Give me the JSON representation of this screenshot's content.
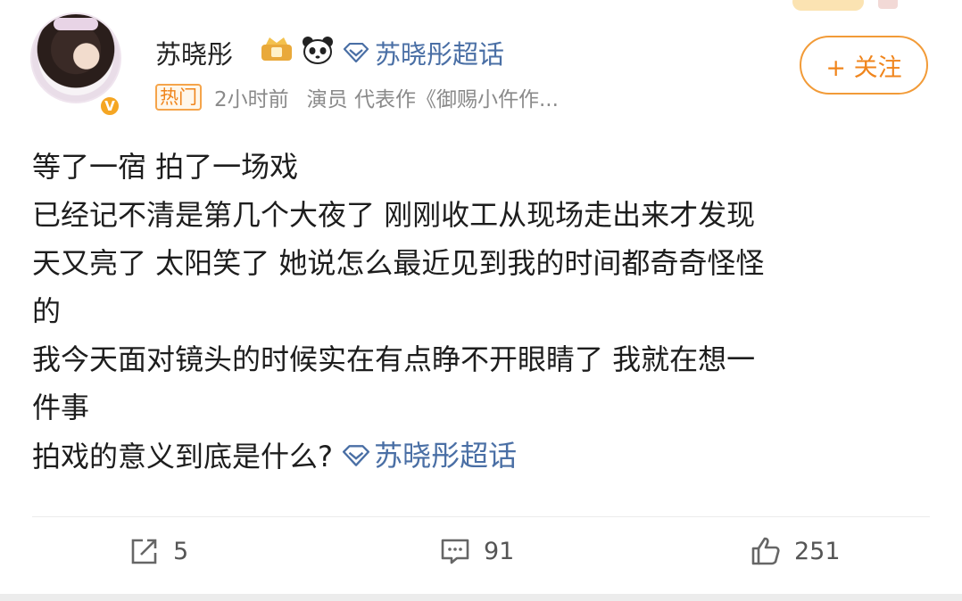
{
  "post": {
    "author": "苏晓彤",
    "topic_link": "苏晓彤超话",
    "hot_badge": "热门",
    "time": "2小时前",
    "bio": "演员 代表作《御赐小仵作...",
    "follow_label": "+ 关注",
    "lines": [
      "等了一宿 拍了一场戏",
      "已经记不清是第几个大夜了 刚刚收工从现场走出来才发现",
      "天又亮了 太阳笑了 她说怎么最近见到我的时间都奇奇怪怪",
      "的",
      "我今天面对镜头的时候实在有点睁不开眼睛了 我就在想一",
      "件事",
      "拍戏的意义到底是什么?"
    ],
    "inline_topic": "苏晓彤超话"
  },
  "actions": {
    "repost_count": "5",
    "comment_count": "91",
    "like_count": "251"
  },
  "icons": [
    "crown-badge-icon",
    "panda-icon",
    "diamond-icon",
    "verified-v-icon",
    "repost-icon",
    "comment-icon",
    "like-icon"
  ],
  "colors": {
    "accent": "#f0851c",
    "link": "#4a6fa5"
  }
}
